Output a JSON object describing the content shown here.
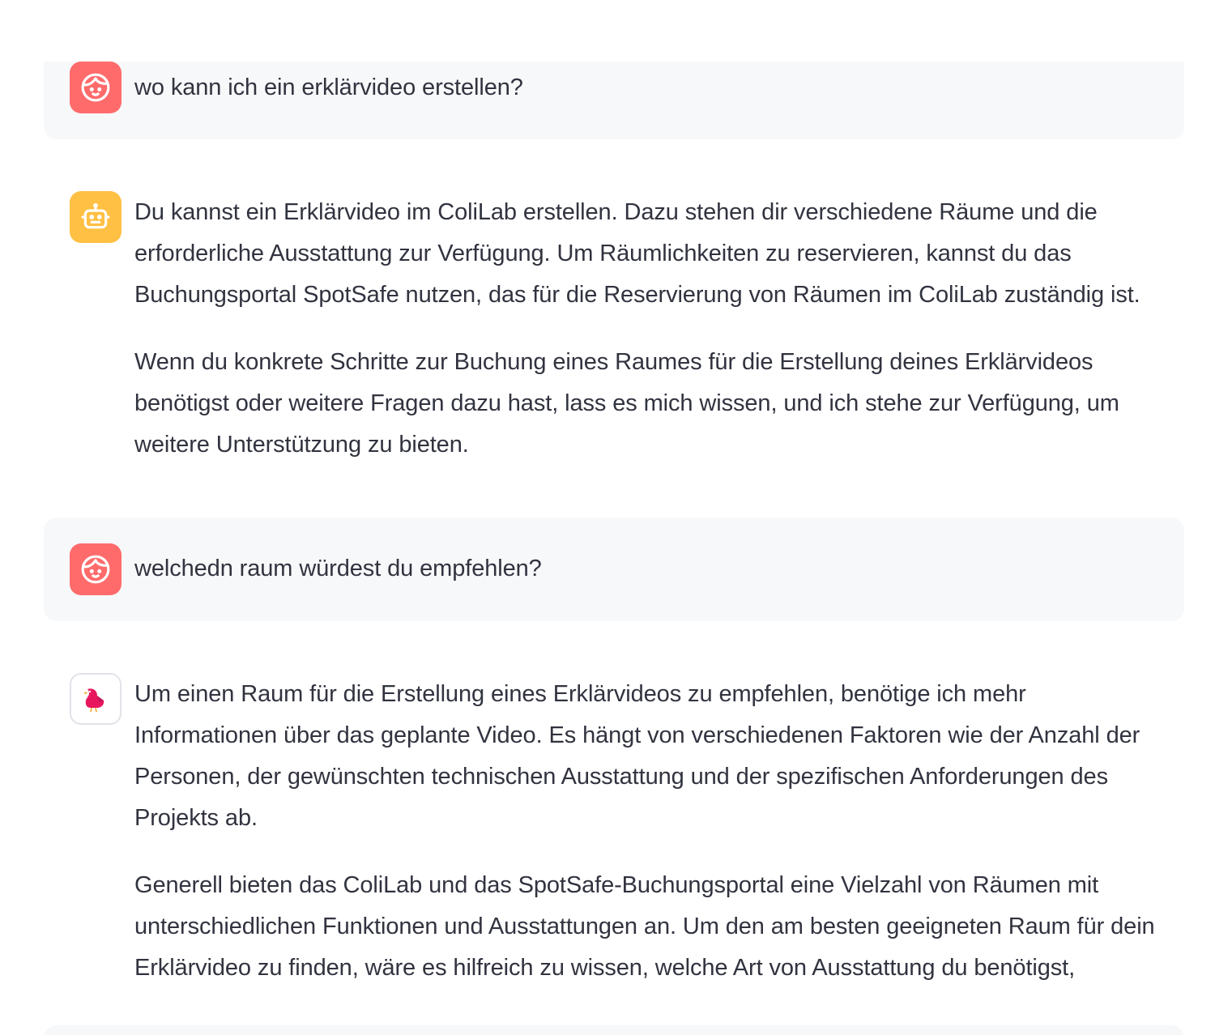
{
  "messages": [
    {
      "role": "user",
      "avatar_icon": "user-face-icon",
      "paragraphs": [
        "wo kann ich ein erklärvideo erstellen?"
      ]
    },
    {
      "role": "assistant",
      "avatar_icon": "robot-icon",
      "paragraphs": [
        "Du kannst ein Erklärvideo im ColiLab erstellen. Dazu stehen dir verschiedene Räume und die erforderliche Ausstattung zur Verfügung. Um Räumlichkeiten zu reservieren, kannst du das Buchungsportal SpotSafe nutzen, das für die Reservierung von Räumen im ColiLab zuständig ist.",
        "Wenn du konkrete Schritte zur Buchung eines Raumes für die Erstellung deines Erklärvideos benötigst oder weitere Fragen dazu hast, lass es mich wissen, und ich stehe zur Verfügung, um weitere Unterstützung zu bieten."
      ]
    },
    {
      "role": "user",
      "avatar_icon": "user-face-icon",
      "paragraphs": [
        "welchedn raum würdest du empfehlen?"
      ]
    },
    {
      "role": "assistant",
      "avatar_icon": "bird-icon",
      "paragraphs": [
        "Um einen Raum für die Erstellung eines Erklärvideos zu empfehlen, benötige ich mehr Informationen über das geplante Video. Es hängt von verschiedenen Faktoren wie der Anzahl der Personen, der gewünschten technischen Ausstattung und der spezifischen Anforderungen des Projekts ab.",
        "Generell bieten das ColiLab und das SpotSafe-Buchungsportal eine Vielzahl von Räumen mit unterschiedlichen Funktionen und Ausstattungen an. Um den am besten geeigneten Raum für dein Erklärvideo zu finden, wäre es hilfreich zu wissen, welche Art von Ausstattung du benötigst,"
      ]
    }
  ],
  "colors": {
    "user_bubble_bg": "#f7f8fa",
    "user_avatar_bg": "#ff6b6b",
    "bot_avatar_bg": "#ffc043",
    "text": "#31333f"
  }
}
